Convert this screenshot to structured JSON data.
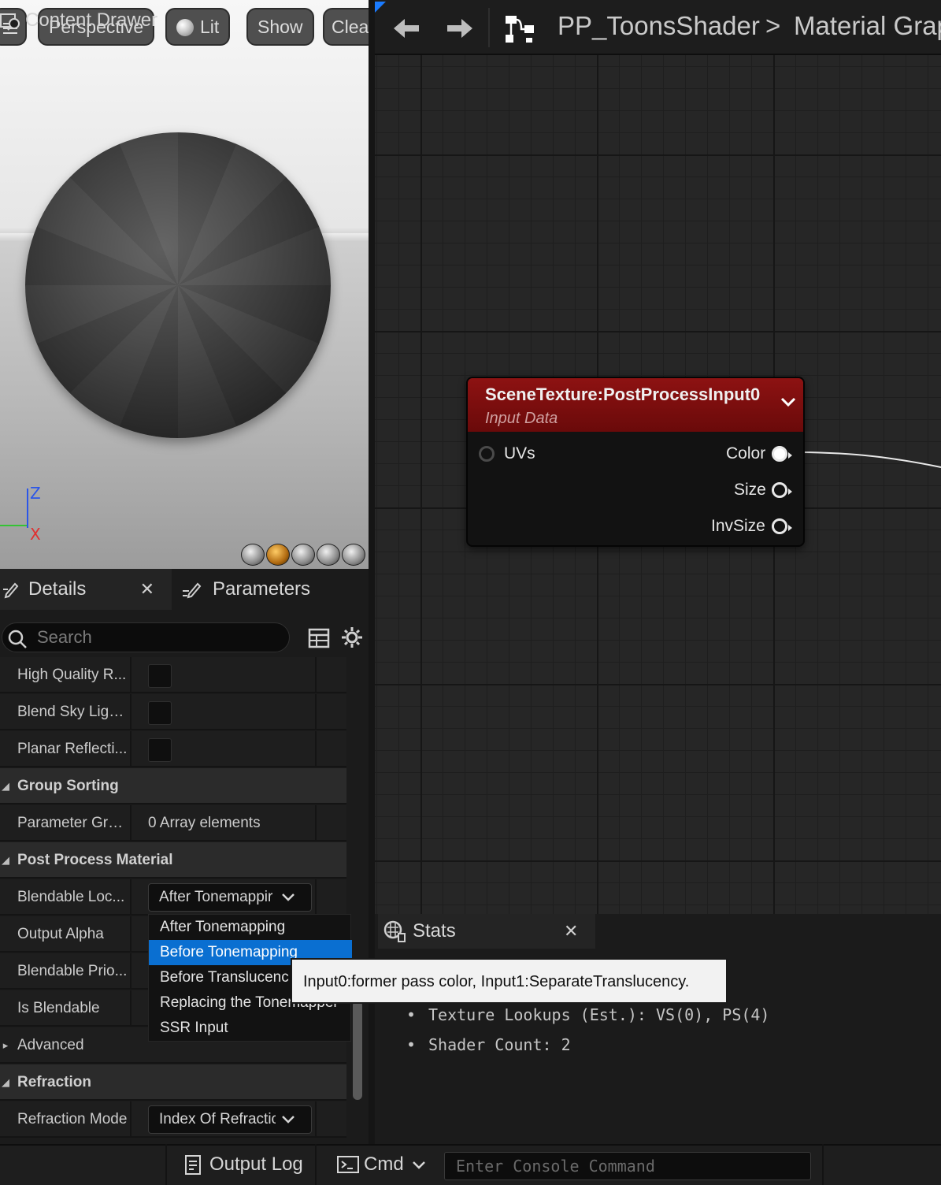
{
  "viewport": {
    "toolbar": {
      "perspective": "Perspective",
      "lit": "Lit",
      "show": "Show",
      "clear": "Clea"
    },
    "axes": {
      "z": "Z",
      "x": "X"
    }
  },
  "details": {
    "tabs": {
      "details": "Details",
      "parameters": "Parameters"
    },
    "search_placeholder": "Search",
    "rows": {
      "high_quality": "High Quality R...",
      "blend_sky": "Blend Sky Ligh...",
      "planar": "Planar Reflecti...",
      "group_sorting": "Group Sorting",
      "parameter_groups": "Parameter Gro...",
      "parameter_groups_value": "0 Array elements",
      "post_process": "Post Process Material",
      "blendable_location": "Blendable Loc...",
      "blendable_location_value": "After Tonemappir",
      "output_alpha": "Output Alpha",
      "blendable_priority": "Blendable Prio...",
      "is_blendable": "Is Blendable",
      "advanced": "Advanced",
      "refraction": "Refraction",
      "refraction_mode": "Refraction Mode",
      "refraction_mode_value": "Index Of Refractic"
    },
    "dropdown": [
      "After Tonemapping",
      "Before Tonemapping",
      "Before Translucenc",
      "Replacing the Tonemapper",
      "SSR Input"
    ],
    "dropdown_selected": "Before Tonemapping",
    "tooltip": "Input0:former pass color, Input1:SeparateTranslucency."
  },
  "graph": {
    "breadcrumb": {
      "asset": "PP_ToonsShader",
      "separator": ">",
      "graph": "Material Grap"
    },
    "node": {
      "title": "SceneTexture:PostProcessInput0",
      "subtitle": "Input Data",
      "input_pin": "UVs",
      "output_pins": [
        "Color",
        "Size",
        "InvSize"
      ]
    },
    "header_color": "#8d1212"
  },
  "stats": {
    "tab": "Stats",
    "lines": [
      "Texture Lookups (Est.): VS(0), PS(4)",
      "Shader Count: 2"
    ]
  },
  "bottombar": {
    "content_drawer": "Content Drawer",
    "output_log": "Output Log",
    "cmd": "Cmd",
    "console_placeholder": "Enter Console Command"
  },
  "colors": {
    "accent": "#0a6fd1"
  }
}
